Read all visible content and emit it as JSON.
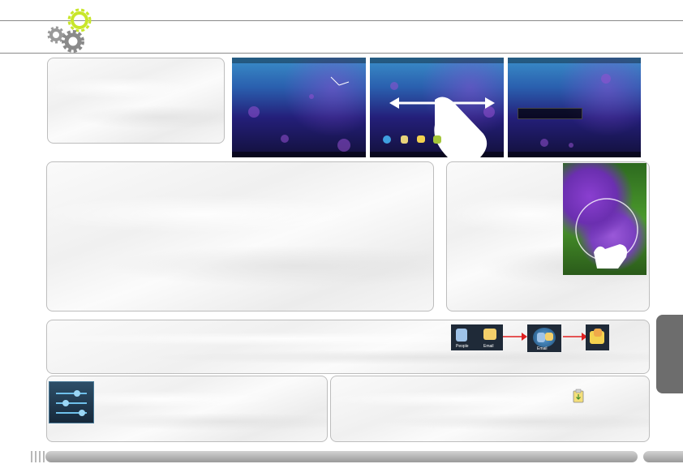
{
  "header": {
    "icon": "gears-icon"
  },
  "screenshots": {
    "icons": [
      "search-icon",
      "clock-icon",
      "battery-icon",
      "wifi-icon"
    ],
    "swipe_hint": "swipe-arrows-icon",
    "dock_items": [
      "globe-icon",
      "clipboard-icon",
      "folder-icon",
      "android-icon"
    ]
  },
  "flower_image": {
    "description_icon": "pinch-zoom-icon"
  },
  "apps_row": {
    "people_label": "People",
    "email_label": "Email",
    "folder_label": "Email",
    "arrow_color": "#e02020"
  },
  "settings_panel": {
    "icon": "settings-sliders-icon"
  },
  "download_panel": {
    "icon": "download-icon"
  },
  "colors": {
    "frame_line": "#8a8a8a",
    "tab": "#6d6d6d",
    "gear_accent": "#c8e62a"
  }
}
